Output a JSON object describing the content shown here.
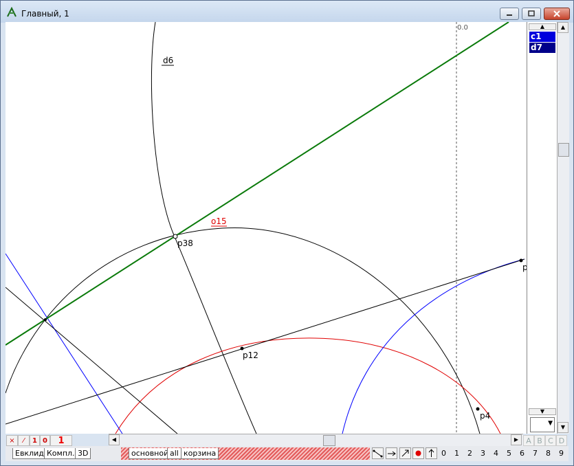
{
  "window": {
    "title": "Главный, 1"
  },
  "canvas": {
    "axis_label": "0.0",
    "labels": {
      "d6": "d6",
      "o15": "o15",
      "p38": "p38",
      "p12": "p12",
      "p4": "p4",
      "p_edge": "p"
    }
  },
  "object_list": {
    "items": [
      "c1",
      "d7"
    ]
  },
  "toolbar_left": {
    "x": "×",
    "slash": "⁄",
    "one": "1",
    "zero": "0",
    "big_one": "1"
  },
  "abcd": [
    "A",
    "B",
    "C",
    "D"
  ],
  "tabs_left": [
    "Евклид",
    "Компл.",
    "3D"
  ],
  "tabs_layers": [
    "основной",
    "all",
    "корзина"
  ],
  "digits": [
    "0",
    "1",
    "2",
    "3",
    "4",
    "5",
    "6",
    "7",
    "8",
    "9"
  ],
  "colors": {
    "green_line": "#0a7a0a",
    "red_curve": "#e00000",
    "blue_curve": "#0000ff",
    "selected": "#0000dd"
  }
}
